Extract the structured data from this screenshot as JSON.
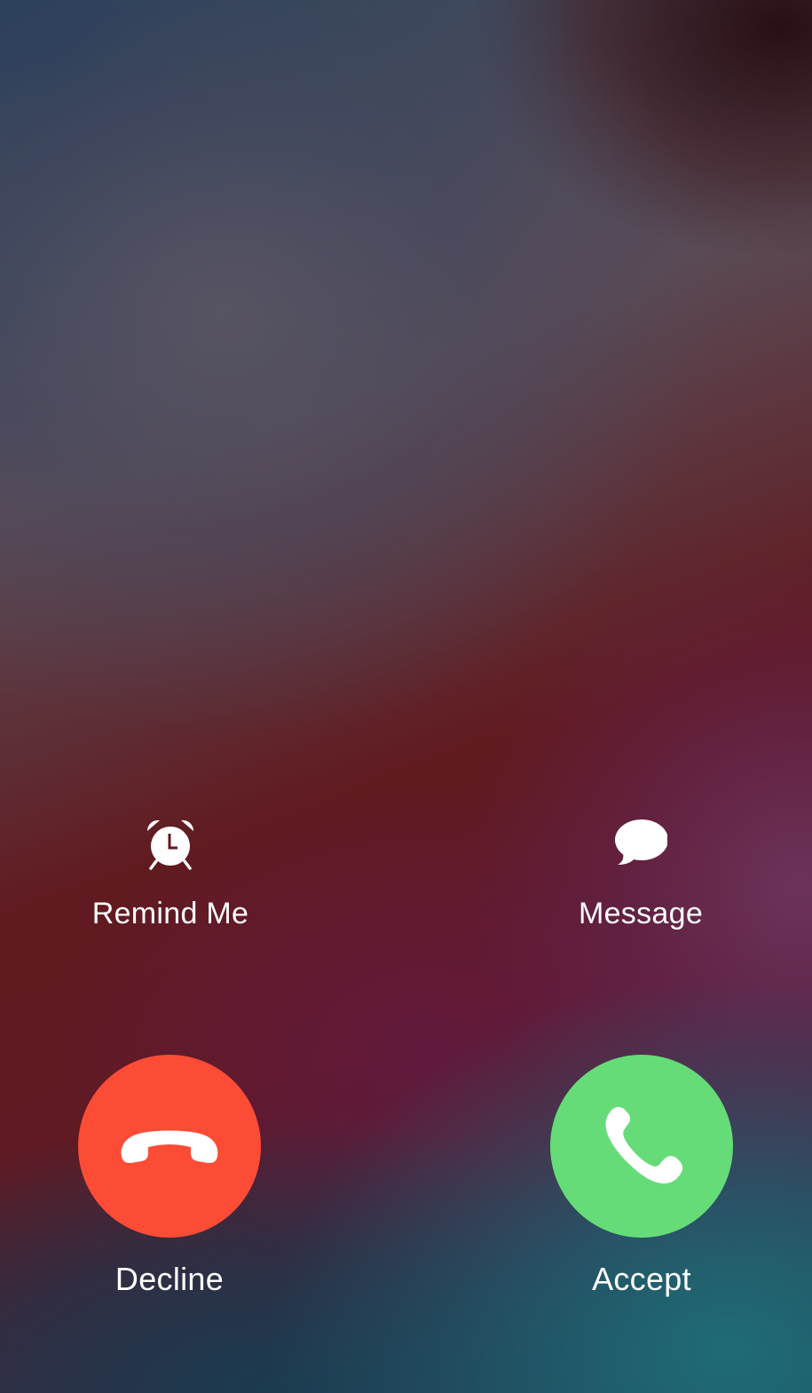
{
  "actions": {
    "remind": {
      "label": "Remind Me",
      "icon": "alarm-clock-icon"
    },
    "message": {
      "label": "Message",
      "icon": "speech-bubble-icon"
    }
  },
  "call": {
    "decline": {
      "label": "Decline",
      "icon": "phone-hangup-icon",
      "color": "#fc4c36"
    },
    "accept": {
      "label": "Accept",
      "icon": "phone-icon",
      "color": "#65dc78"
    }
  },
  "colors": {
    "text": "#ffffff"
  }
}
